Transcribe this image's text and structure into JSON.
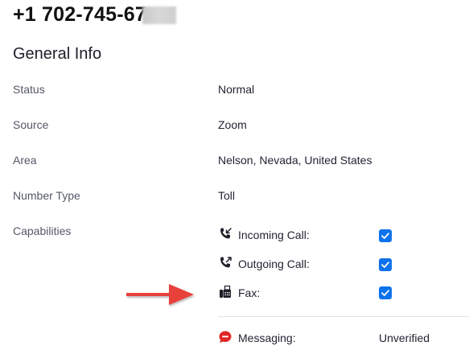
{
  "header": {
    "phone_number": "+1 702-745-67"
  },
  "general_info": {
    "title": "General Info",
    "rows": [
      {
        "label": "Status",
        "value": "Normal"
      },
      {
        "label": "Source",
        "value": "Zoom"
      },
      {
        "label": "Area",
        "value": "Nelson, Nevada, United States"
      },
      {
        "label": "Number Type",
        "value": "Toll"
      }
    ],
    "capabilities": {
      "label": "Capabilities",
      "items": [
        {
          "icon": "incoming-call-icon",
          "label": "Incoming Call:",
          "checked": true
        },
        {
          "icon": "outgoing-call-icon",
          "label": "Outgoing Call:",
          "checked": true
        },
        {
          "icon": "fax-icon",
          "label": "Fax:",
          "checked": true
        }
      ],
      "messaging": {
        "icon": "messaging-icon",
        "label": "Messaging:",
        "status": "Unverified"
      }
    }
  },
  "colors": {
    "checkbox": "#0e72ed",
    "arrow": "#e8403a",
    "messaging_icon": "#e02828"
  }
}
